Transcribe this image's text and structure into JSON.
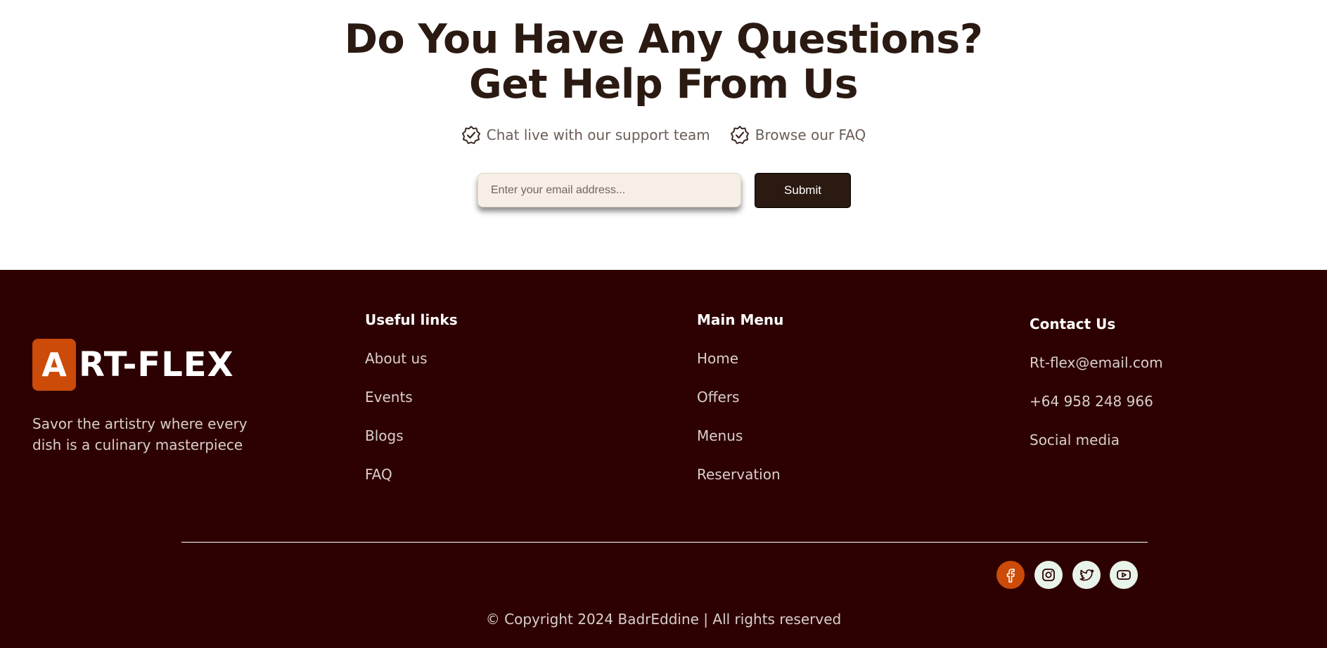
{
  "cta": {
    "title_line1": "Do You Have Any Questions?",
    "title_line2": "Get Help From Us",
    "features": [
      {
        "icon": "badge-check-icon",
        "label": "Chat live with our support team"
      },
      {
        "icon": "badge-check-icon",
        "label": "Browse our FAQ"
      }
    ],
    "email_placeholder": "Enter your email address...",
    "email_value": "",
    "submit_label": "Submit"
  },
  "footer": {
    "logo": {
      "badge_letter": "A",
      "text": "RT-FLEX"
    },
    "tagline": "Savor the artistry where every dish is a culinary masterpiece",
    "useful_links": {
      "heading": "Useful links",
      "items": [
        "About us",
        "Events",
        "Blogs",
        "FAQ"
      ]
    },
    "main_menu": {
      "heading": "Main Menu",
      "items": [
        "Home",
        "Offers",
        "Menus",
        "Reservation"
      ]
    },
    "contact": {
      "heading": "Contact Us",
      "items": [
        "Rt-flex@email.com",
        "+64 958 248 966",
        "Social media"
      ]
    },
    "social": [
      {
        "icon": "facebook-icon",
        "bg": "#cc4b08",
        "fg": "#ffffff"
      },
      {
        "icon": "instagram-icon",
        "bg": "#e8f3ea",
        "fg": "#2d0101"
      },
      {
        "icon": "twitter-icon",
        "bg": "#e8f3ea",
        "fg": "#2d0101"
      },
      {
        "icon": "youtube-icon",
        "bg": "#e8f3ea",
        "fg": "#2d0101"
      }
    ],
    "copyright": "© Copyright 2024 BadrEddine | All rights reserved"
  },
  "colors": {
    "dark_brown": "#2b1a12",
    "footer_bg": "#2d0101",
    "accent_orange": "#cc4b08",
    "input_bg": "#f7efe6"
  }
}
